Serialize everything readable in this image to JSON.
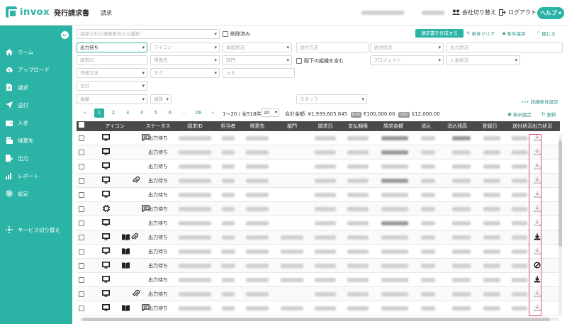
{
  "header": {
    "logo_text": "invox",
    "logo_sub": "発行請求書",
    "page_name": "請求",
    "switch_company": "会社切り替え",
    "logout": "ログアウト",
    "help": "ヘルプ"
  },
  "sidebar": {
    "items": [
      {
        "label": "ホーム",
        "icon": "home-icon"
      },
      {
        "label": "アップロード",
        "icon": "cloud-upload-icon"
      },
      {
        "label": "請求",
        "icon": "document-icon"
      },
      {
        "label": "送付",
        "icon": "send-icon"
      },
      {
        "label": "入金",
        "icon": "wallet-icon"
      },
      {
        "label": "得意先",
        "icon": "building-icon"
      },
      {
        "label": "出力",
        "icon": "export-icon"
      },
      {
        "label": "レポート",
        "icon": "chart-icon"
      },
      {
        "label": "設定",
        "icon": "gear-icon"
      }
    ],
    "service_switch": "サービス切り替え"
  },
  "filters": {
    "saved_search_placeholder": "保存された検索条件から選択",
    "deleted_label": "削除済み",
    "create_invoice": "請求書を作成する",
    "clear": "条件クリア",
    "save": "条件保存",
    "close": "閉じる",
    "status_value": "出力待ち",
    "icon_placeholder": "アイコン",
    "approval_placeholder": "承認状況",
    "send_method_placeholder": "送付方法",
    "send_status_placeholder": "送付状況",
    "output_status_placeholder": "出力状況",
    "invoice_id_placeholder": "請求ID",
    "customer_placeholder": "得意先",
    "department_placeholder": "部門",
    "include_sub_label": "配下の組織を含む",
    "project_placeholder": "プロジェクト",
    "payment_status_placeholder": "入金状況",
    "creation_method_placeholder": "作成方法",
    "tag_placeholder": "タグ",
    "memo_placeholder": "メモ",
    "date_placeholder": "日付",
    "amount_placeholder": "金額",
    "comparison_placeholder": "通貨",
    "staff_placeholder": "スタッフ",
    "detail_settings": "詳細条件設定"
  },
  "pager": {
    "pages": [
      "1",
      "2",
      "3",
      "4",
      "5",
      "6",
      "...",
      "26"
    ],
    "range_text": "1〜20 / 全518件",
    "per_page": "20",
    "total_label": "合計金額",
    "total_jpy": "¥1,939,605,845",
    "eur_label": "EUR",
    "total_eur": "€100,000.00",
    "usd_label": "USD",
    "total_usd": "$12,000.00",
    "display_settings": "表示設定",
    "refresh": "更新"
  },
  "table": {
    "columns": [
      "アイコン",
      "ステータス",
      "請求ID",
      "担当者",
      "得意先",
      "部門",
      "請求日",
      "支払期限",
      "請求金額",
      "消込",
      "消込残高",
      "登録日",
      "送付状況",
      "出力状況"
    ],
    "rows": [
      {
        "status": "出力待ち",
        "icons": [
          "monitor",
          "comment"
        ],
        "output": "download-faded"
      },
      {
        "status": "出力待ち",
        "icons": [
          "monitor"
        ],
        "output": "download-faded"
      },
      {
        "status": "出力待ち",
        "icons": [
          "monitor"
        ],
        "output": "download-faded"
      },
      {
        "status": "出力待ち",
        "icons": [
          "monitor",
          "clip"
        ],
        "output": "download-faded"
      },
      {
        "status": "出力待ち",
        "icons": [
          "monitor"
        ],
        "output": "download-faded"
      },
      {
        "status": "出力待ち",
        "icons": [
          "chip",
          "comment"
        ],
        "output": "download-faded"
      },
      {
        "status": "出力待ち",
        "icons": [
          "monitor"
        ],
        "output": "download-faded"
      },
      {
        "status": "出力待ち",
        "icons": [
          "monitor",
          "book",
          "clip"
        ],
        "output": "download-dark"
      },
      {
        "status": "出力待ち",
        "icons": [
          "monitor",
          "book"
        ],
        "output": "download-faded"
      },
      {
        "status": "出力待ち",
        "icons": [
          "monitor",
          "book"
        ],
        "output": "ban"
      },
      {
        "status": "出力待ち",
        "icons": [
          "monitor"
        ],
        "output": "download-dark"
      },
      {
        "status": "出力待ち",
        "icons": [
          "monitor",
          "clip"
        ],
        "output": "download-faded"
      },
      {
        "status": "出力待ち",
        "icons": [
          "monitor",
          "book",
          "comment"
        ],
        "output": "download-faded"
      }
    ]
  }
}
